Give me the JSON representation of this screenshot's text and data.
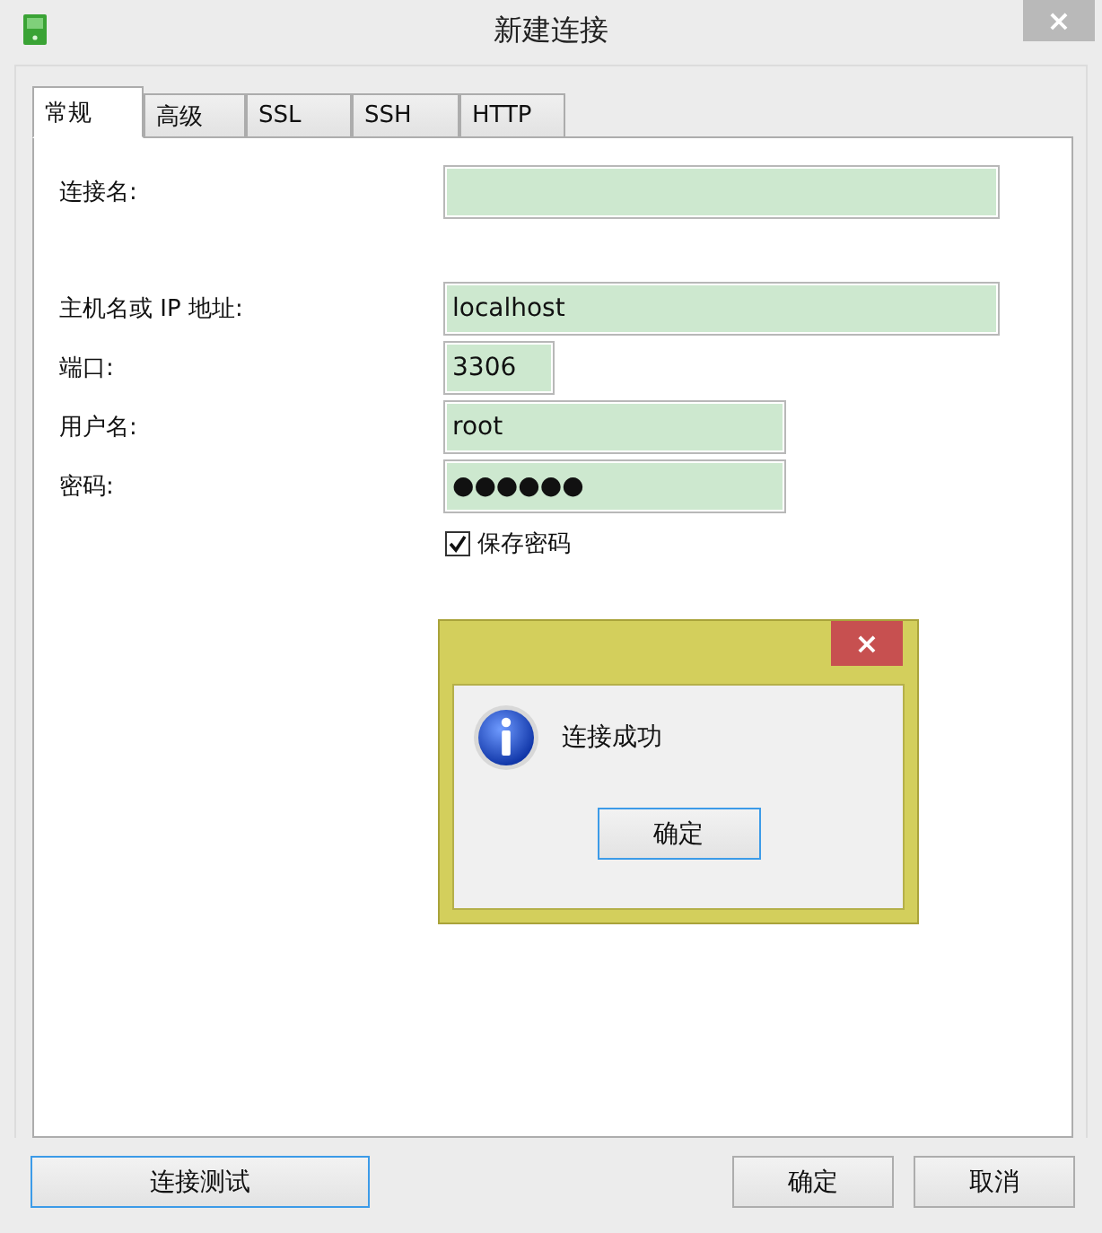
{
  "window": {
    "title": "新建连接",
    "close": "×"
  },
  "tabs": [
    {
      "label": "常规",
      "selected": true
    },
    {
      "label": "高级",
      "selected": false
    },
    {
      "label": "SSL",
      "selected": false
    },
    {
      "label": "SSH",
      "selected": false
    },
    {
      "label": "HTTP",
      "selected": false
    }
  ],
  "form": {
    "fields": [
      {
        "label": "连接名:"
      },
      {
        "label": "主机名或 IP 地址:",
        "value": "localhost"
      },
      {
        "label": "端口:",
        "value": "3306"
      },
      {
        "label": "用户名:",
        "value": "root"
      },
      {
        "label": "密码:",
        "value": "●●●●●●"
      }
    ],
    "save_password": {
      "label": "保存密码",
      "checked": true
    }
  },
  "buttons": [
    {
      "label": "连接测试",
      "focused": true
    },
    {
      "label": "确定",
      "focused": false
    },
    {
      "label": "取消",
      "focused": false
    }
  ],
  "message_box": {
    "close": "×",
    "message": "连接成功",
    "button": {
      "label": "确定",
      "focused": true
    }
  }
}
